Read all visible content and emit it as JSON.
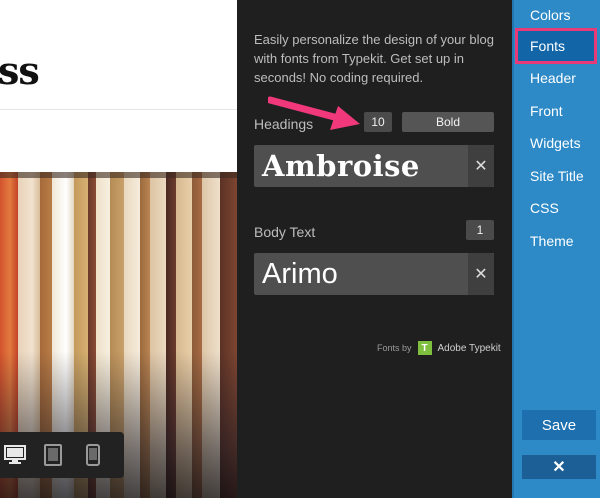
{
  "preview": {
    "logo_text": "ss",
    "device_icons": [
      "desktop-icon",
      "tablet-icon",
      "phone-icon"
    ]
  },
  "panel": {
    "intro": "Easily personalize the design of your blog with fonts from Typekit. Get set up in seconds! No coding required.",
    "headings": {
      "label": "Headings",
      "size": "10",
      "weight": "Bold",
      "font": "Ambroise",
      "clear": "✕"
    },
    "body_text": {
      "label": "Body Text",
      "size": "1",
      "font": "Arimo",
      "clear": "✕"
    },
    "credit": {
      "prefix": "Fonts by",
      "logo": "T",
      "name": "Adobe Typekit"
    }
  },
  "sidebar": {
    "items": [
      {
        "label": "Colors"
      },
      {
        "label": "Fonts"
      },
      {
        "label": "Header"
      },
      {
        "label": "Front"
      },
      {
        "label": "Widgets"
      },
      {
        "label": "Site Title"
      },
      {
        "label": "CSS"
      },
      {
        "label": "Theme"
      }
    ],
    "active_index": 1,
    "save_label": "Save",
    "close_label": "✕"
  },
  "colors": {
    "sidebar_bg": "#2d8ac7",
    "active_outline": "#e83a77",
    "arrow": "#f0387a",
    "panel_bg": "#1f1f1f"
  }
}
